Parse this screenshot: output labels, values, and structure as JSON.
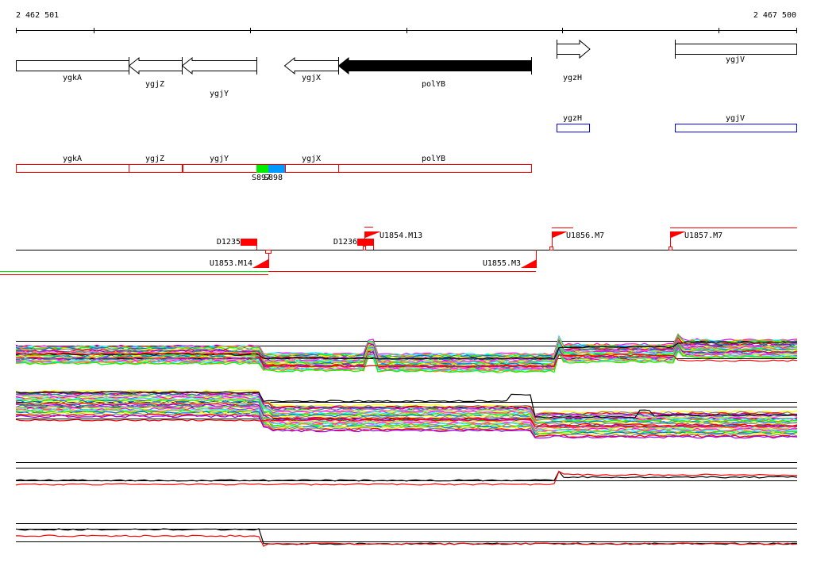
{
  "ruler": {
    "start_label": "2 462 501",
    "end_label": "2 467 500"
  },
  "genes_track": [
    {
      "name": "ygkA",
      "strand": "none"
    },
    {
      "name": "ygjZ",
      "strand": "minus"
    },
    {
      "name": "ygjY",
      "strand": "minus"
    },
    {
      "name": "ygjX",
      "strand": "minus"
    },
    {
      "name": "polYB",
      "strand": "minus",
      "highlighted": true
    },
    {
      "name": "ygzH",
      "strand": "plus"
    },
    {
      "name": "ygjV",
      "strand": "none"
    }
  ],
  "blue_track": [
    {
      "name": "ygzH"
    },
    {
      "name": "ygjV"
    }
  ],
  "red_track": {
    "genes": [
      "ygkA",
      "ygjZ",
      "ygjY",
      "ygjX",
      "polYB"
    ],
    "features": [
      {
        "name": "S897",
        "color": "#00ee00"
      },
      {
        "name": "S898",
        "color": "#0099ff"
      }
    ]
  },
  "markers": {
    "deletions": [
      "D1235",
      "D1236"
    ],
    "flags": [
      "U1853.M14",
      "U1854.M13",
      "U1855.M3",
      "U1856.M7",
      "U1857.M7"
    ]
  },
  "colors": {
    "feature_red": "#ff0000",
    "feature_blue": "#0000ff",
    "line": "#000000"
  }
}
